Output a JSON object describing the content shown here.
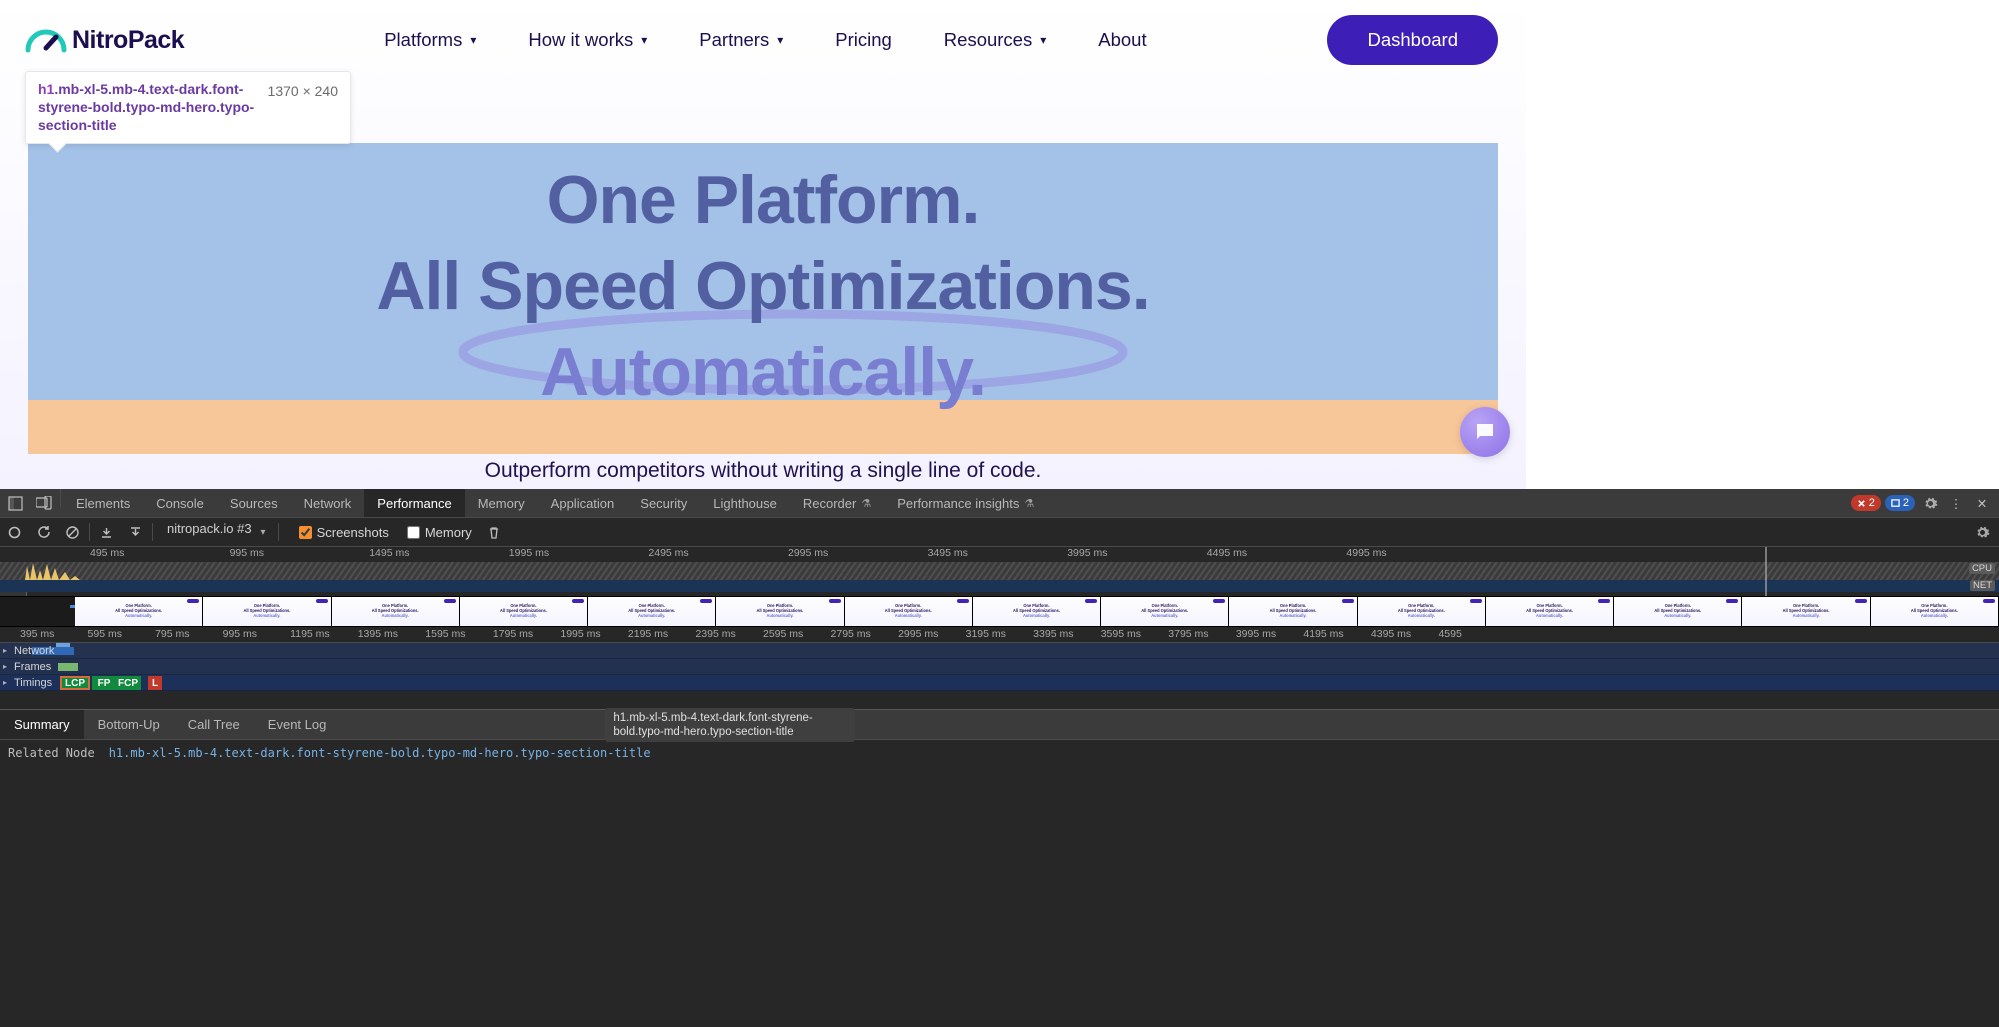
{
  "nav": {
    "logo_text": "NitroPack",
    "items": [
      {
        "label": "Platforms",
        "dropdown": true
      },
      {
        "label": "How it works",
        "dropdown": true
      },
      {
        "label": "Partners",
        "dropdown": true
      },
      {
        "label": "Pricing",
        "dropdown": false
      },
      {
        "label": "Resources",
        "dropdown": true
      },
      {
        "label": "About",
        "dropdown": false
      }
    ],
    "cta": "Dashboard"
  },
  "inspect_tooltip": {
    "tag": "h1",
    "classes": ".mb-xl-5.mb-4.text-dark.font-styrene-bold.typo-md-hero.typo-section-title",
    "dims": "1370 × 240"
  },
  "hero": {
    "line1": "One Platform.",
    "line2": "All Speed Optimizations.",
    "accent": "Automatically.",
    "sub": "Outperform competitors without writing a single line of code."
  },
  "devtools": {
    "tabs": [
      "Elements",
      "Console",
      "Sources",
      "Network",
      "Performance",
      "Memory",
      "Application",
      "Security",
      "Lighthouse",
      "Recorder",
      "Performance insights"
    ],
    "active_tab": "Performance",
    "flask_tabs": [
      "Recorder",
      "Performance insights"
    ],
    "err_count": "2",
    "info_count": "2",
    "toolbar": {
      "context": "nitropack.io #3",
      "screenshots_label": "Screenshots",
      "screenshots_checked": true,
      "memory_label": "Memory",
      "memory_checked": false
    },
    "overview_ticks": [
      "495 ms",
      "995 ms",
      "1495 ms",
      "1995 ms",
      "2495 ms",
      "2995 ms",
      "3495 ms",
      "3995 ms",
      "4495 ms",
      "4995 ms"
    ],
    "overview_labels": {
      "cpu": "CPU",
      "net": "NET"
    },
    "main_ticks": [
      "395 ms",
      "595 ms",
      "795 ms",
      "995 ms",
      "1195 ms",
      "1395 ms",
      "1595 ms",
      "1795 ms",
      "1995 ms",
      "2195 ms",
      "2395 ms",
      "2595 ms",
      "2795 ms",
      "2995 ms",
      "3195 ms",
      "3395 ms",
      "3595 ms",
      "3795 ms",
      "3995 ms",
      "4195 ms",
      "4395 ms",
      "4595"
    ],
    "tracks": {
      "network": "Network",
      "frames": "Frames",
      "timings": "Timings",
      "timing_markers": [
        "LCP",
        "FP",
        "FCP",
        "L"
      ]
    },
    "filmstrip": {
      "frame_count": 15,
      "mini_lines": [
        "One Platform.",
        "All Speed Optimizations.",
        "Automatically."
      ]
    },
    "summary_tabs": [
      "Summary",
      "Bottom-Up",
      "Call Tree",
      "Event Log"
    ],
    "summary_active": "Summary",
    "summary_float": "h1.mb-xl-5.mb-4.text-dark.font-styrene-bold.typo-md-hero.typo-section-title",
    "related_label": "Related Node",
    "related_node": "h1.mb-xl-5.mb-4.text-dark.font-styrene-bold.typo-md-hero.typo-section-title"
  }
}
